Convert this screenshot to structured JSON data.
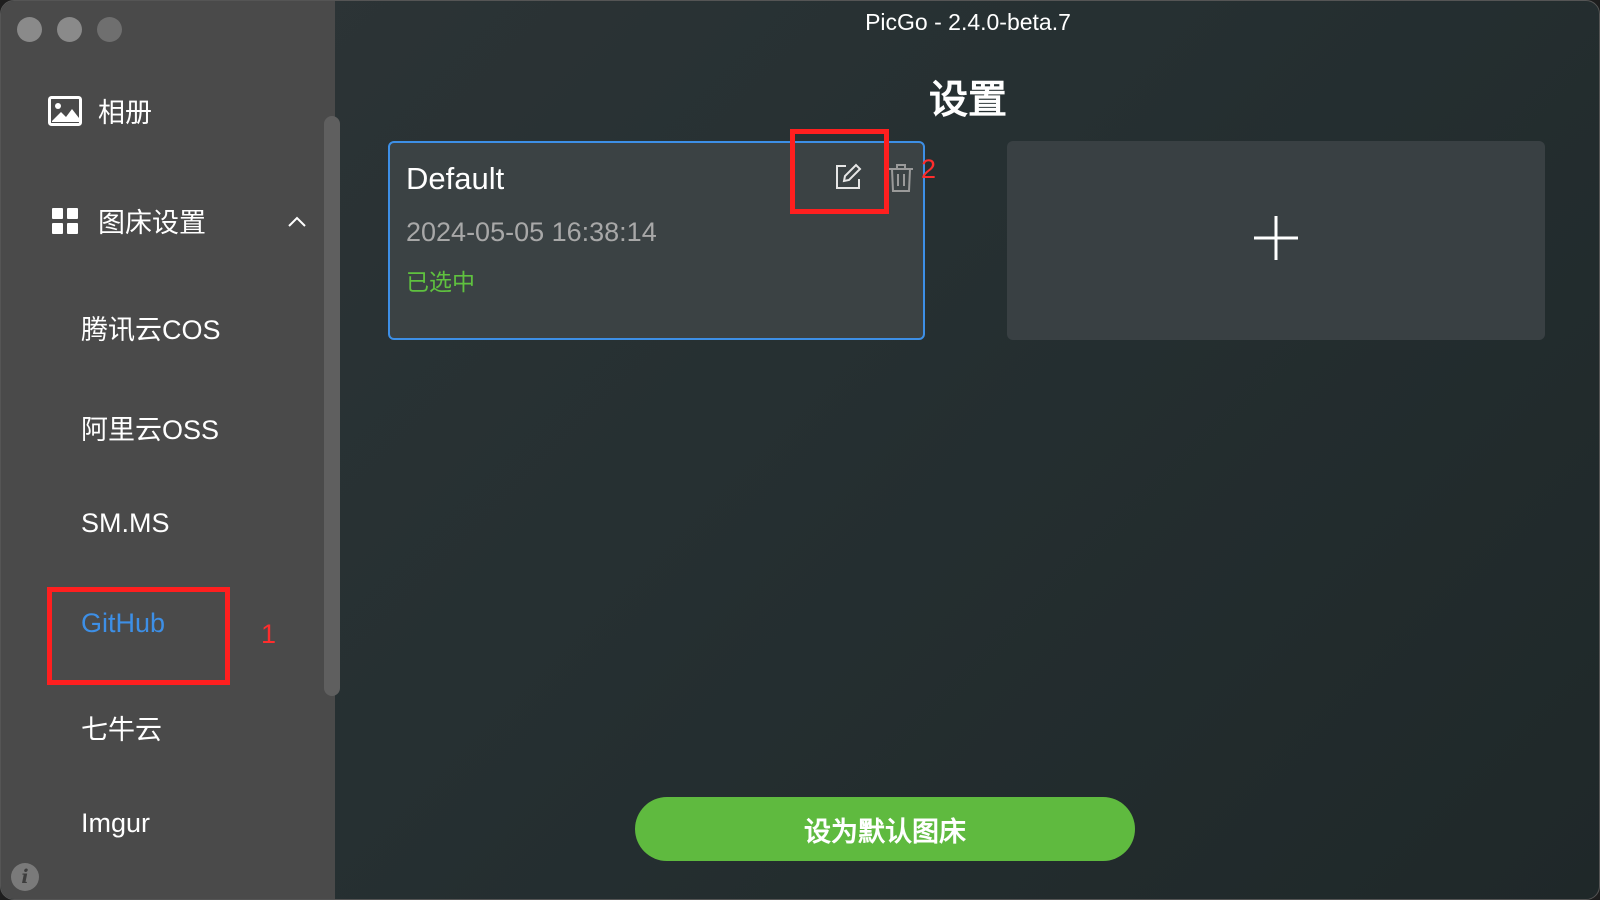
{
  "window": {
    "title": "PicGo - 2.4.0-beta.7"
  },
  "sidebar": {
    "album_label": "相册",
    "picbed_settings_label": "图床设置",
    "picbed_items": [
      {
        "label": "腾讯云COS",
        "active": false
      },
      {
        "label": "阿里云OSS",
        "active": false
      },
      {
        "label": "SM.MS",
        "active": false
      },
      {
        "label": "GitHub",
        "active": true
      },
      {
        "label": "七牛云",
        "active": false
      },
      {
        "label": "Imgur",
        "active": false
      }
    ],
    "info_glyph": "i"
  },
  "main": {
    "title": "设置",
    "config_card": {
      "name": "Default",
      "date": "2024-05-05 16:38:14",
      "status": "已选中"
    },
    "set_default_label": "设为默认图床"
  },
  "annotations": {
    "first": "1",
    "second": "2"
  },
  "colors": {
    "accent_blue": "#3d8fe6",
    "selected_green": "#5fc13f",
    "button_green": "#5fba3f",
    "annotation_red": "#ff1f1f"
  },
  "icons": [
    "image-icon",
    "grid-icon",
    "chevron-up-icon",
    "edit-icon",
    "trash-icon",
    "plus-icon",
    "info-icon"
  ]
}
